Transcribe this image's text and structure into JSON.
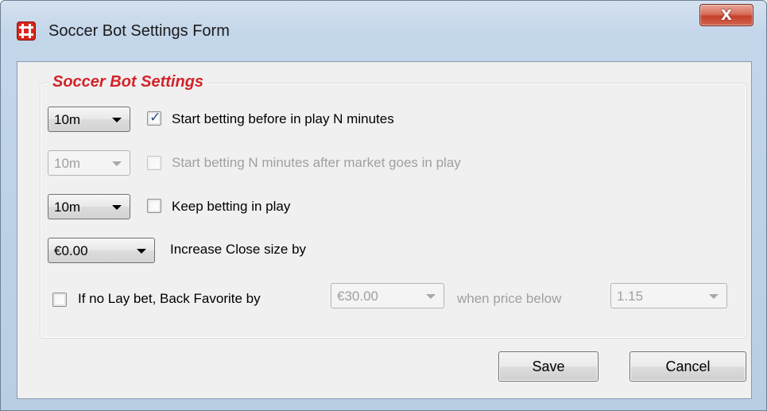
{
  "window": {
    "title": "Soccer Bot Settings Form",
    "close_label": "X"
  },
  "group": {
    "title": "Soccer Bot Settings"
  },
  "rows": {
    "before_inplay": {
      "combo_value": "10m",
      "checked": true,
      "label": "Start betting before in play N minutes",
      "enabled": true
    },
    "after_inplay": {
      "combo_value": "10m",
      "checked": false,
      "label": "Start betting N minutes after market goes in play",
      "enabled": false
    },
    "keep_betting": {
      "combo_value": "10m",
      "checked": false,
      "label": "Keep betting in play",
      "enabled": true
    },
    "increase_close": {
      "combo_value": "€0.00",
      "label": "Increase Close size by"
    },
    "back_favorite": {
      "checked": false,
      "label": "If no Lay bet, Back Favorite by",
      "amount_value": "€30.00",
      "when_label": "when price below",
      "price_value": "1.15"
    }
  },
  "buttons": {
    "save_label": "Save",
    "cancel_label": "Cancel"
  },
  "colors": {
    "group_title": "#d2232a",
    "title_bar": "#bfd3e8",
    "close_button": "#c5412a"
  }
}
